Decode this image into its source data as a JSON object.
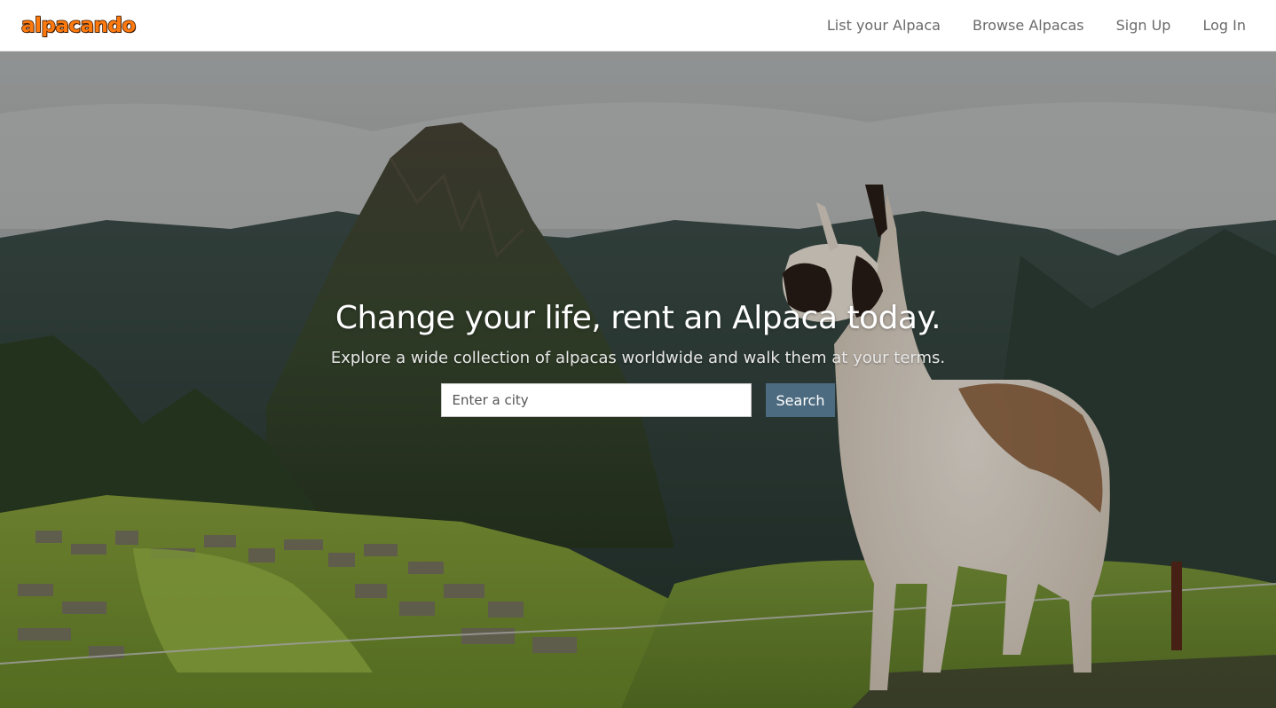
{
  "brand": {
    "logo_text": "alpacando",
    "logo_fill": "#ff7a0e",
    "logo_outline": "#3a1800"
  },
  "nav": {
    "items": [
      {
        "label": "List your Alpaca"
      },
      {
        "label": "Browse Alpacas"
      },
      {
        "label": "Sign Up"
      },
      {
        "label": "Log In"
      }
    ]
  },
  "hero": {
    "title": "Change your life, rent an Alpaca today.",
    "subtitle": "Explore a wide collection of alpacas worldwide and walk them at your terms.",
    "search": {
      "placeholder": "Enter a city",
      "value": "",
      "button_label": "Search"
    },
    "button_color": "#4d6b80"
  }
}
